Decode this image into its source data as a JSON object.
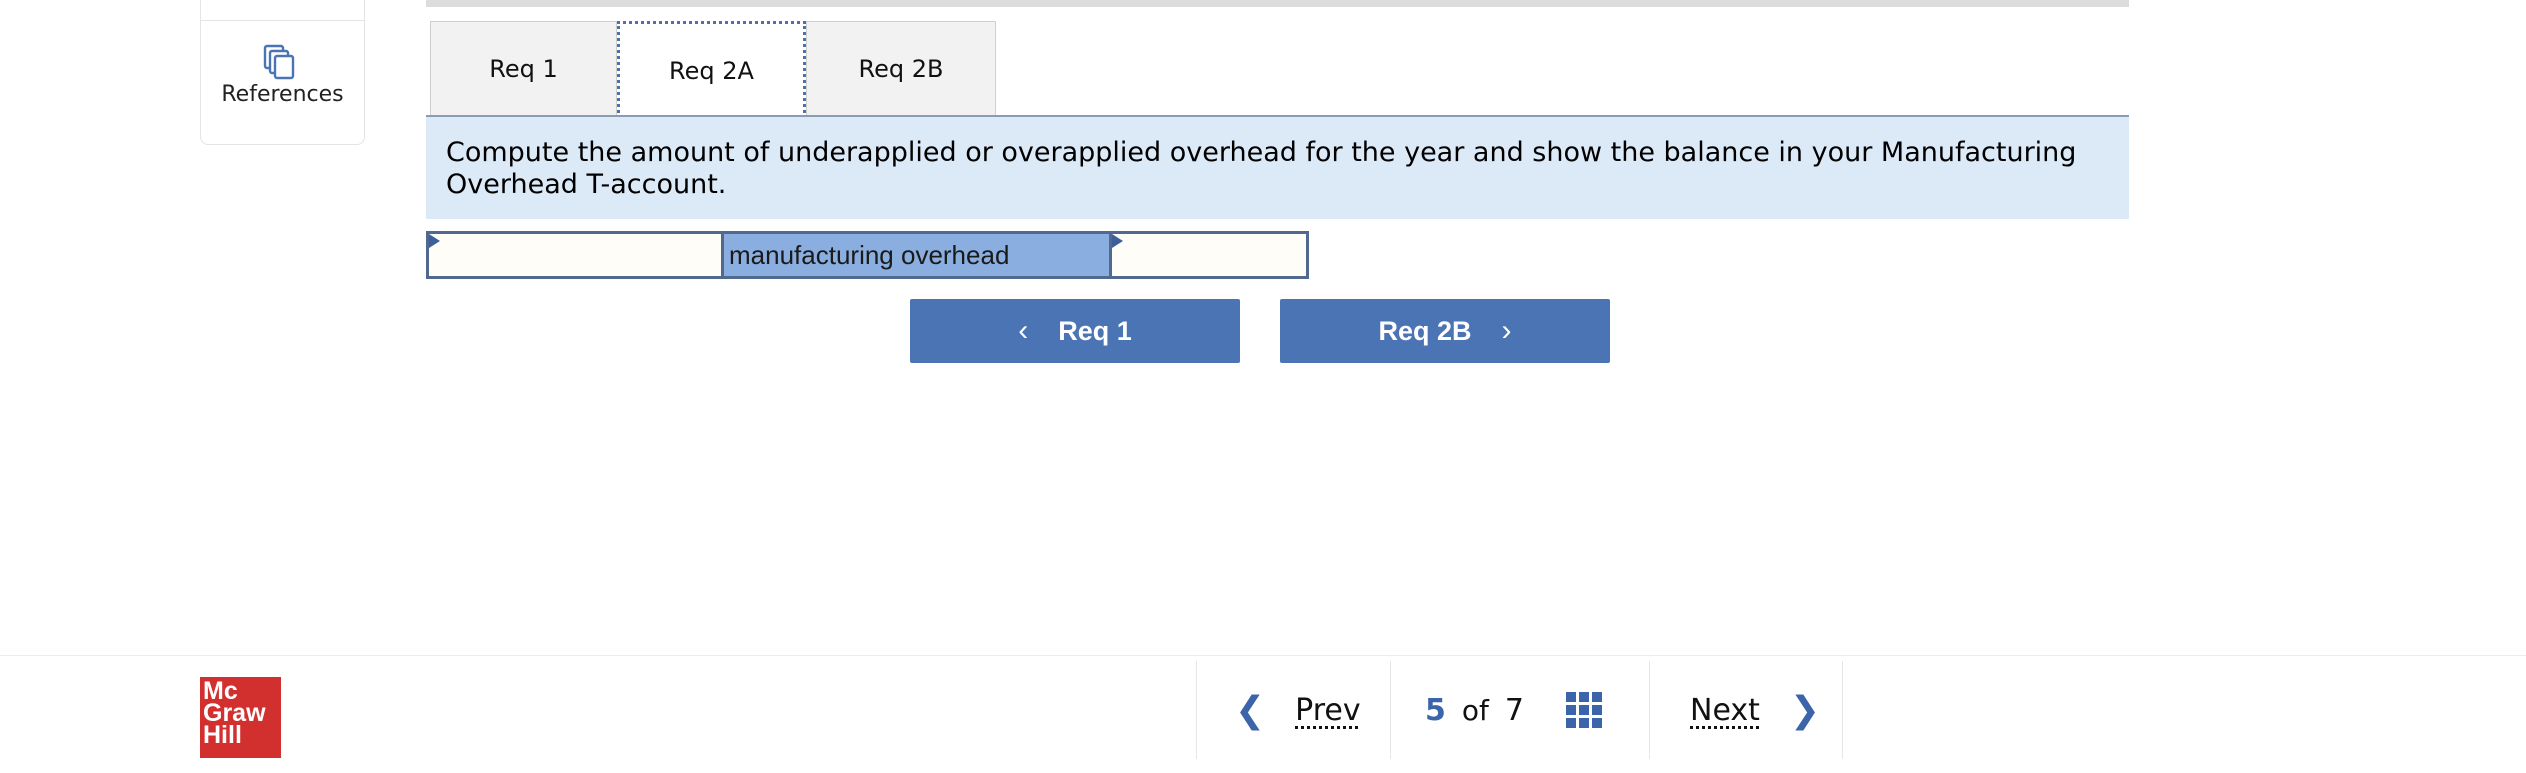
{
  "references": {
    "label": "References",
    "icon": "documents-icon"
  },
  "tabs": [
    {
      "label": "Req 1",
      "active": false
    },
    {
      "label": "Req 2A",
      "active": true
    },
    {
      "label": "Req 2B",
      "active": false
    }
  ],
  "instruction": "Compute the amount of underapplied or overapplied overhead for the year and show the balance in your Manufacturing Overhead T-account.",
  "t_account": {
    "left_value": "",
    "title": "manufacturing overhead",
    "right_value": ""
  },
  "req_nav": {
    "prev_label": "Req 1",
    "next_label": "Req 2B"
  },
  "footer": {
    "logo": [
      "Mc",
      "Graw",
      "Hill"
    ],
    "prev_label": "Prev",
    "next_label": "Next",
    "current_page": "5",
    "of_label": "of",
    "total_pages": "7"
  },
  "colors": {
    "accent": "#4a74b4",
    "instruction_bg": "#dce9f7",
    "t_title_bg": "#8aaee0",
    "logo_red": "#d2302f"
  }
}
